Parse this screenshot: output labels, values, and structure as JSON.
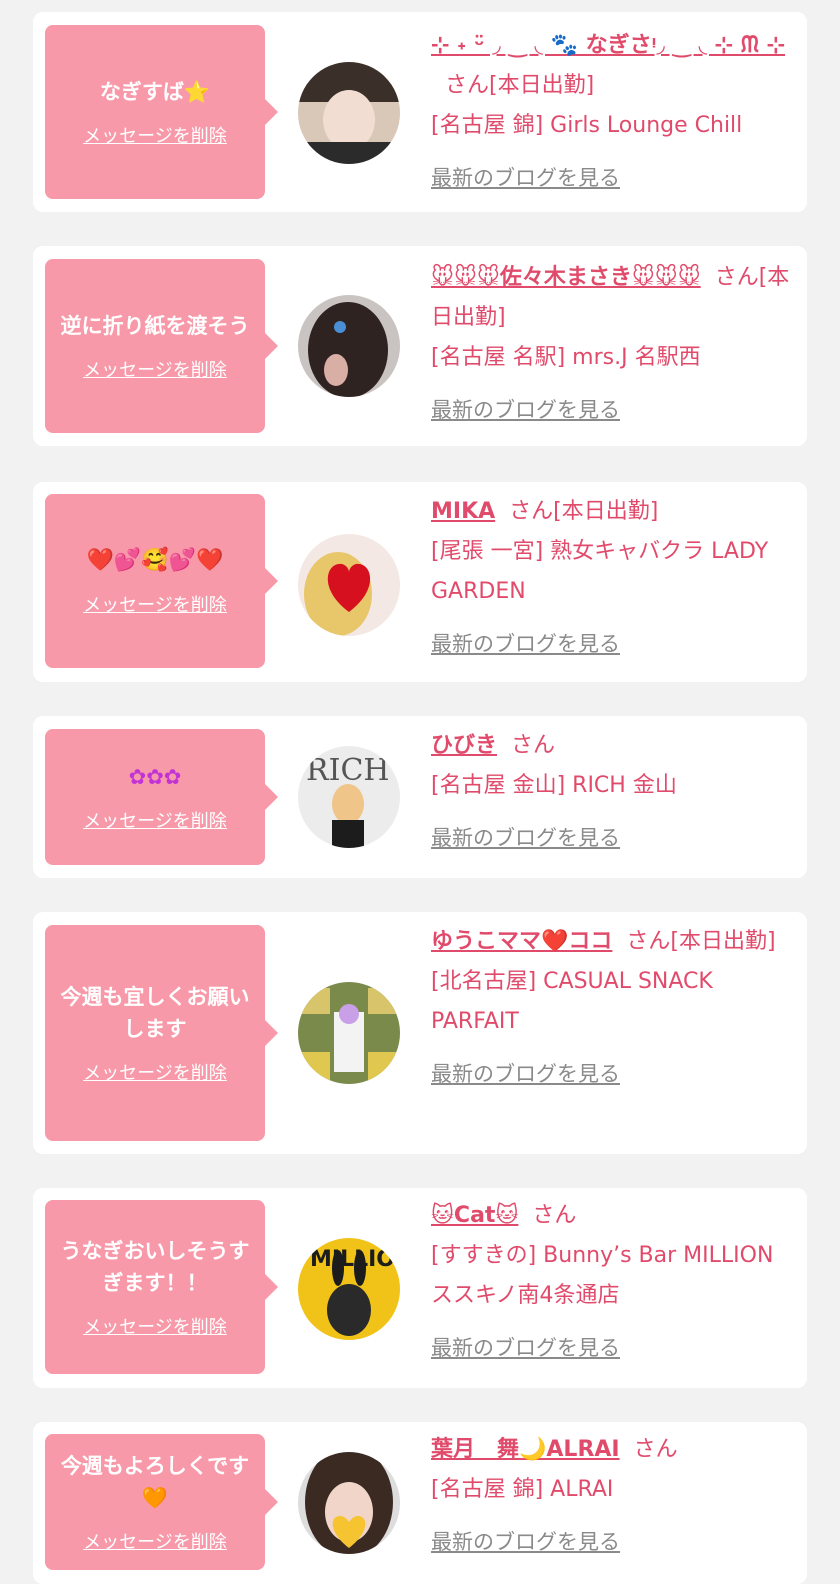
{
  "common": {
    "delete_label": "メッセージを削除",
    "blog_label": "最新のブログを見る",
    "suffix_working": "さん[本日出勤]",
    "suffix_plain": "さん"
  },
  "items": [
    {
      "message": "なぎすば⭐",
      "name": "⊹ ˖ ᵕ̈ ◞ ‿ ◟ 🐾 なぎさᵎ◞ ‿ ◟ ⊹ ᙏ ⊹",
      "suffix": "さん[本日出勤]",
      "shop": "[名古屋 錦] Girls Lounge Chill"
    },
    {
      "message": "逆に折り紙を渡そう",
      "name": "🐭🐭🐭佐々木まさき🐭🐭🐭",
      "suffix": "さん[本日出勤]",
      "shop": "[名古屋 名駅] mrs.J 名駅西"
    },
    {
      "message": "❤️💕🥰💕❤️",
      "name": "MIKA",
      "suffix": "さん[本日出勤]",
      "shop": "[尾張 一宮] 熟女キャバクラ LADY GARDEN"
    },
    {
      "message": "✿✿✿",
      "name": "ひびき",
      "suffix": "さん",
      "shop": "[名古屋 金山] RICH 金山"
    },
    {
      "message": "今週も宜しくお願いします",
      "name": "ゆうこママ❤️ココ",
      "suffix": "さん[本日出勤]",
      "shop": "[北名古屋] CASUAL SNACK PARFAIT"
    },
    {
      "message": "うなぎおいしそうすぎます！！",
      "name": "🐱Cat🐱",
      "suffix": "さん",
      "shop": "[すすきの] Bunny’s Bar MILLION ススキノ南4条通店"
    },
    {
      "message": "今週もよろしくです🧡",
      "name": "葉月　舞🌙ALRAI",
      "suffix": "さん",
      "shop": "[名古屋 錦] ALRAI"
    }
  ]
}
